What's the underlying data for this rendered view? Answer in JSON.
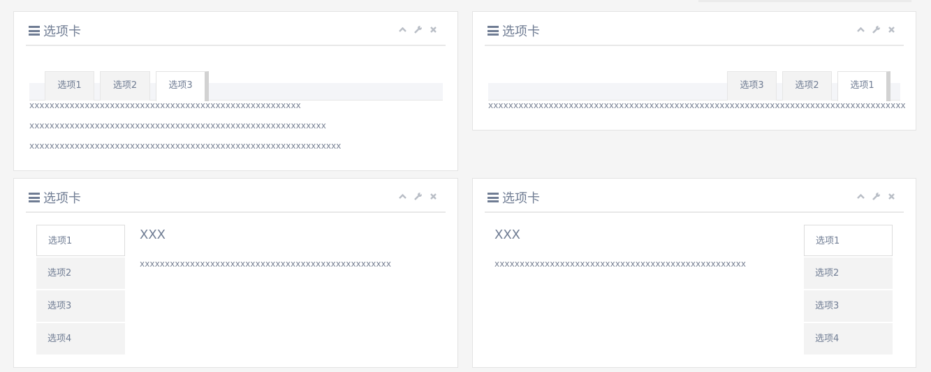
{
  "panels": [
    {
      "title": "选项卡",
      "tabs": [
        "选项1",
        "选项2",
        "选项3"
      ],
      "active_tab": "选项3",
      "lines": [
        "xxxxxxxxxxxxxxxxxxxxxxxxxxxxxxxxxxxxxxxxxxxxxxxxxxxxxx",
        "xxxxxxxxxxxxxxxxxxxxxxxxxxxxxxxxxxxxxxxxxxxxxxxxxxxxxxxxxxx",
        "xxxxxxxxxxxxxxxxxxxxxxxxxxxxxxxxxxxxxxxxxxxxxxxxxxxxxxxxxxxxxx"
      ]
    },
    {
      "title": "选项卡",
      "tabs": [
        "选项3",
        "选项2",
        "选项1"
      ],
      "active_tab": "选项1",
      "lines": [
        "xxxxxxxxxxxxxxxxxxxxxxxxxxxxxxxxxxxxxxxxxxxxxxxxxxxxxxxxxxxxxxxxxxxxxxxxxxxxxxxxxxx"
      ]
    },
    {
      "title": "选项卡",
      "tabs": [
        "选项1",
        "选项2",
        "选项3",
        "选项4"
      ],
      "active_tab": "选项1",
      "heading": "XXX",
      "line": "xxxxxxxxxxxxxxxxxxxxxxxxxxxxxxxxxxxxxxxxxxxxxxxxxx"
    },
    {
      "title": "选项卡",
      "tabs": [
        "选项1",
        "选项2",
        "选项3",
        "选项4"
      ],
      "active_tab": "选项1",
      "heading": "XXX",
      "line": "xxxxxxxxxxxxxxxxxxxxxxxxxxxxxxxxxxxxxxxxxxxxxxxxxx"
    }
  ],
  "icons": {
    "menu": "hamburger-icon",
    "collapse": "chevron-up-icon",
    "config": "wrench-icon",
    "close": "close-icon"
  },
  "colors": {
    "background": "#f5f5f5",
    "text": "#7a8395",
    "title": "#6f7c93",
    "tool": "#b9bec6"
  }
}
